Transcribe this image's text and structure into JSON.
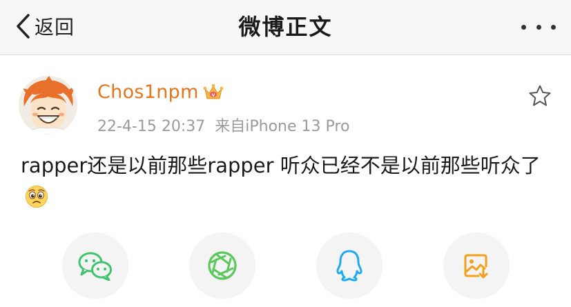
{
  "navbar": {
    "back_label": "返回",
    "title": "微博正文",
    "more_icon": "more-dots-icon"
  },
  "post": {
    "username": "Chos1npm",
    "badge_icon": "vip-crown-icon",
    "timestamp": "22-4-15 20:37",
    "source": "来自iPhone 13 Pro",
    "text": "rapper还是以前那些rapper 听众已经不是以前那些听众了",
    "emoji_icon": "pitiful-face-emoji",
    "favorite_icon": "star-outline-icon"
  },
  "share": {
    "buttons": [
      {
        "icon": "wechat-icon",
        "color": "#3ec46d"
      },
      {
        "icon": "moments-icon",
        "color": "#5ac85a"
      },
      {
        "icon": "qq-icon",
        "color": "#1eaaf1"
      },
      {
        "icon": "save-image-icon",
        "color": "#f3a11c"
      }
    ]
  },
  "colors": {
    "username": "#e8741b",
    "meta": "#9a9a9a",
    "navbar_bg": "#f7f7f7"
  }
}
